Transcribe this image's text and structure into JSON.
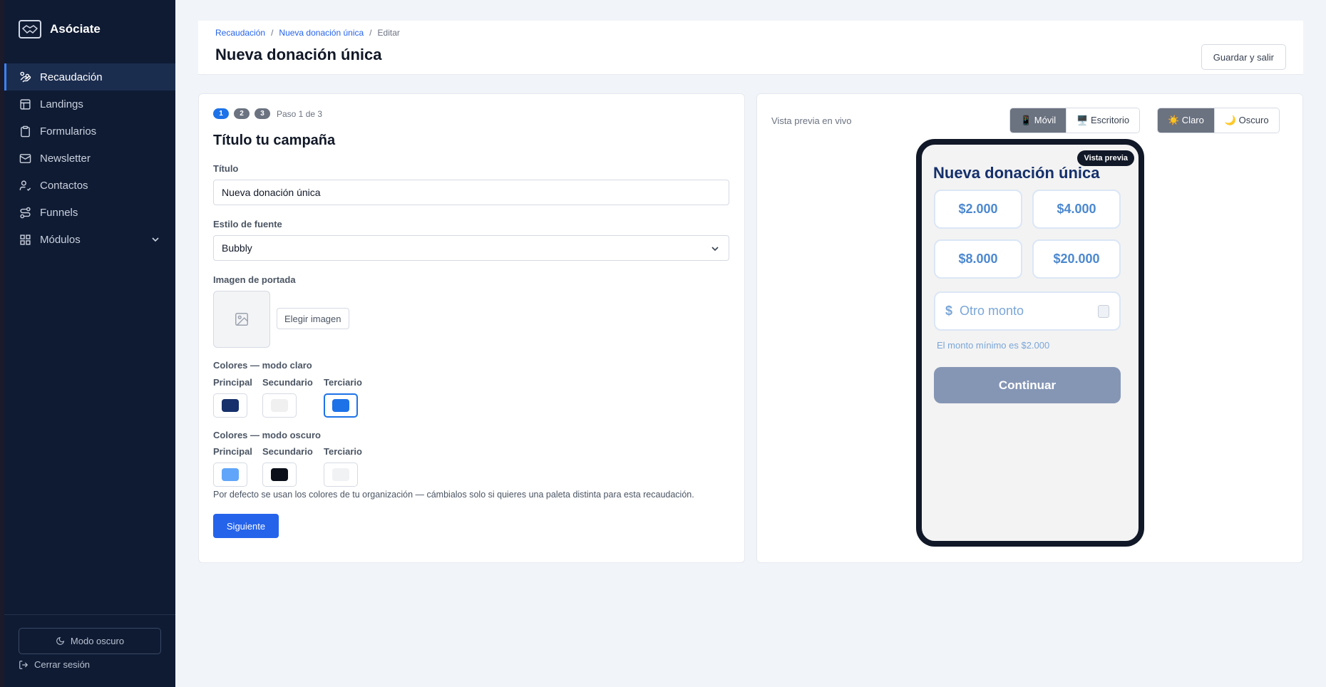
{
  "sidebar": {
    "brand": "Asóciate",
    "items": [
      {
        "label": "Recaudación",
        "icon": "hand-coins-icon",
        "active": true
      },
      {
        "label": "Landings",
        "icon": "layout-icon"
      },
      {
        "label": "Formularios",
        "icon": "clipboard-icon"
      },
      {
        "label": "Newsletter",
        "icon": "mail-icon"
      },
      {
        "label": "Contactos",
        "icon": "user-check-icon"
      },
      {
        "label": "Funnels",
        "icon": "route-icon"
      },
      {
        "label": "Módulos",
        "icon": "grid-icon"
      }
    ],
    "dark_mode": "Modo oscuro",
    "logout": "Cerrar sesión"
  },
  "header": {
    "breadcrumb": [
      "Recaudación",
      "Nueva donación única",
      "Editar"
    ],
    "title": "Nueva donación única",
    "save_exit": "Guardar y salir"
  },
  "form": {
    "steps": [
      "1",
      "2",
      "3"
    ],
    "step_text": "Paso 1 de 3",
    "section_title": "Título tu campaña",
    "title_label": "Título",
    "title_value": "Nueva donación única",
    "font_label": "Estilo de fuente",
    "font_value": "Bubbly",
    "cover_label": "Imagen de portada",
    "choose_image": "Elegir imagen",
    "light_colors_label": "Colores — modo claro",
    "dark_colors_label": "Colores — modo oscuro",
    "swatch_labels": [
      "Principal",
      "Secundario",
      "Terciario"
    ],
    "light_colors": [
      "#15306b",
      "#f0f0f0",
      "#1d72e8"
    ],
    "dark_colors": [
      "#60a5fa",
      "#0b0f19",
      "#f1f2f4"
    ],
    "help": "Por defecto se usan los colores de tu organización — cámbialos solo si quieres una paleta distinta para esta recaudación.",
    "next": "Siguiente"
  },
  "preview": {
    "label": "Vista previa en vivo",
    "device_mobile": "📱 Móvil",
    "device_desktop": "🖥️ Escritorio",
    "theme_light": "☀️ Claro",
    "theme_dark": "🌙 Oscuro",
    "badge": "Vista previa",
    "title": "Nueva donación única",
    "amounts": [
      "$2.000",
      "$4.000",
      "$8.000",
      "$20.000"
    ],
    "currency": "$",
    "other_placeholder": "Otro monto",
    "min_note": "El monto mínimo es $2.000",
    "continue": "Continuar"
  }
}
